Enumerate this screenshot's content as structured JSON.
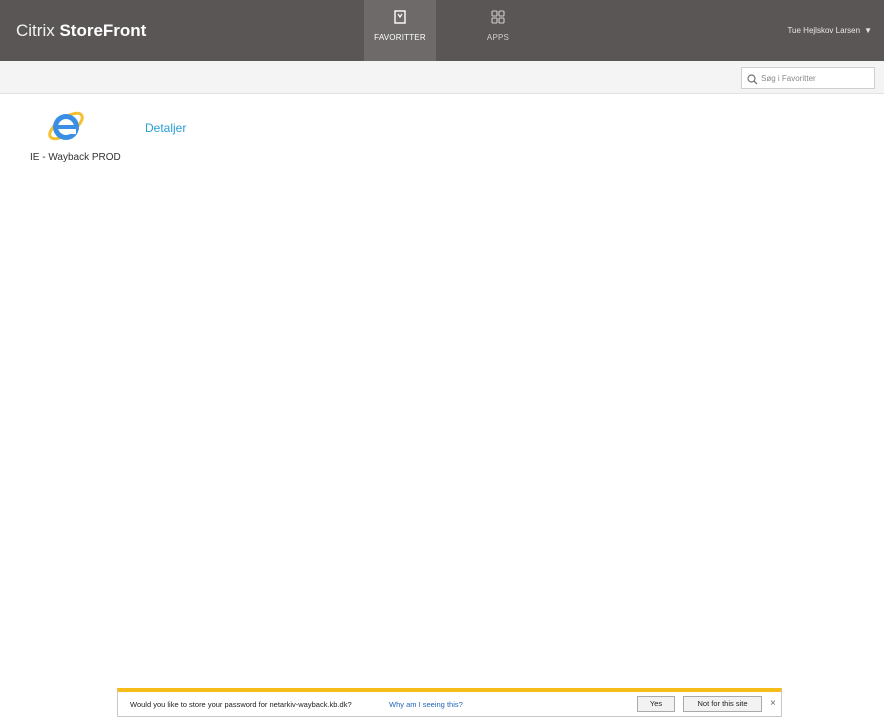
{
  "header": {
    "brand_light": "Citrix ",
    "brand_bold": "StoreFront",
    "tabs": [
      {
        "label": "FAVORITTER",
        "icon": "bookmark-icon",
        "active": true
      },
      {
        "label": "APPS",
        "icon": "apps-grid-icon",
        "active": false
      }
    ],
    "user_name": "Tue Hejlskov Larsen",
    "user_caret": "▼"
  },
  "search": {
    "placeholder": "Søg i Favoritter"
  },
  "apps": [
    {
      "name": "IE - Wayback PROD",
      "icon": "internet-explorer-icon",
      "details_label": "Detaljer"
    }
  ],
  "password_bar": {
    "message": "Would you like to store your password for netarkiv-wayback.kb.dk?",
    "why_link": "Why am I seeing this?",
    "yes_label": "Yes",
    "no_label": "Not for this site",
    "close_label": "×"
  },
  "colors": {
    "topbar": "#5a5656",
    "active_tab": "#6e6a6a",
    "link": "#2a9fd6",
    "notification_accent": "#f6bd1a"
  }
}
